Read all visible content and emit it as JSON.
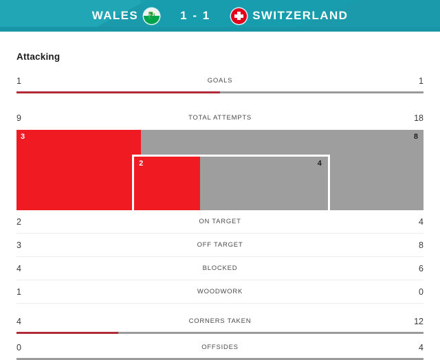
{
  "header": {
    "home_team": "WALES",
    "away_team": "SWITZERLAND",
    "score": "1 - 1",
    "home_flag_icon": "wales-flag-icon",
    "away_flag_icon": "switzerland-flag-icon",
    "background_color": "#1a9aaa"
  },
  "section": {
    "title": "Attacking"
  },
  "colors": {
    "home_bar": "#f01b22",
    "away_bar": "#9e9e9e",
    "thin_bar_home": "#b02a37",
    "thin_bar_away": "#9a9a9a",
    "header_teal": "#1a9aaa"
  },
  "chart_data": {
    "type": "bar",
    "title": "Attacking",
    "home_team": "WALES",
    "away_team": "SWITZERLAND",
    "categories": [
      "GOALS",
      "TOTAL ATTEMPTS",
      "ON TARGET",
      "OFF TARGET",
      "BLOCKED",
      "WOODWORK",
      "CORNERS TAKEN",
      "OFFSIDES"
    ],
    "series": [
      {
        "name": "WALES",
        "values": [
          1,
          9,
          2,
          3,
          4,
          1,
          4,
          0
        ]
      },
      {
        "name": "SWITZERLAND",
        "values": [
          1,
          18,
          4,
          8,
          6,
          0,
          12,
          4
        ]
      }
    ],
    "nested_attempts": {
      "outer_label": "TOTAL ATTEMPTS",
      "outer_home": 3,
      "outer_away": 8,
      "inner_home": 2,
      "inner_away": 4
    },
    "legend": [
      "WALES",
      "SWITZERLAND"
    ],
    "grid": false,
    "orientation": "horizontal-split"
  },
  "rows": {
    "goals": {
      "label": "GOALS",
      "home": "1",
      "away": "1",
      "home_pct": "50%",
      "has_bar": true
    },
    "total_attempts": {
      "label": "TOTAL ATTEMPTS",
      "home": "9",
      "away": "18",
      "has_bar": false
    },
    "attempts_chart": {
      "outer_home": "3",
      "outer_away": "8",
      "outer_home_pct": "30.5%",
      "inner_home": "2",
      "inner_away": "4",
      "inner_left_pct": "28.4%",
      "inner_width_pct": "48.6%",
      "inner_home_pct": "34%"
    },
    "on_target": {
      "label": "ON TARGET",
      "home": "2",
      "away": "4",
      "has_bar": false
    },
    "off_target": {
      "label": "OFF TARGET",
      "home": "3",
      "away": "8",
      "has_bar": false
    },
    "blocked": {
      "label": "BLOCKED",
      "home": "4",
      "away": "6",
      "has_bar": false
    },
    "woodwork": {
      "label": "WOODWORK",
      "home": "1",
      "away": "0",
      "has_bar": false
    },
    "corners_taken": {
      "label": "CORNERS TAKEN",
      "home": "4",
      "away": "12",
      "home_pct": "25%",
      "has_bar": true
    },
    "offsides": {
      "label": "OFFSIDES",
      "home": "0",
      "away": "4",
      "home_pct": "0%",
      "has_bar": true
    }
  }
}
